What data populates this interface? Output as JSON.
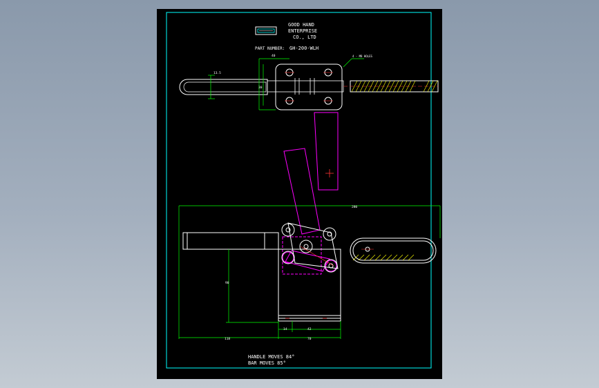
{
  "title_block": {
    "company_line1": "GOOD HAND",
    "company_line2": "ENTERPRISE",
    "company_line3": "CO., LTD",
    "part_number_label": "PART NUMBER:",
    "part_number_value": "GH-200-WLH"
  },
  "dimensions": {
    "top_width": "40",
    "top_left_height": "30",
    "top_side": "13.5",
    "hole_callout": "4 - M8 HOLES",
    "overall_length": "280",
    "vertical_height": "90",
    "bottom_segment_a": "14",
    "bottom_segment_b": "42",
    "bottom_total_left": "118",
    "bottom_total_right": "70"
  },
  "notes": {
    "handle_moves": "HANDLE MOVES  84°",
    "bar_moves": "BAR        MOVES  85°"
  },
  "colors": {
    "frame": "#00ffff",
    "part_outline": "#ffffff",
    "dimension": "#00ff00",
    "alt_position": "#ff00ff",
    "hatch": "#ffff00",
    "center": "#ff3333"
  }
}
